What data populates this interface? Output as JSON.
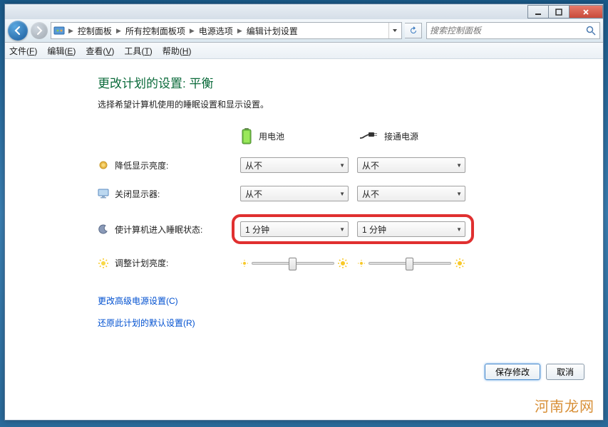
{
  "breadcrumb": {
    "items": [
      "控制面板",
      "所有控制面板项",
      "电源选项",
      "编辑计划设置"
    ]
  },
  "search": {
    "placeholder": "搜索控制面板"
  },
  "menubar": {
    "file": "文件",
    "file_u": "F",
    "edit": "编辑",
    "edit_u": "E",
    "view": "查看",
    "view_u": "V",
    "tools": "工具",
    "tools_u": "T",
    "help": "帮助",
    "help_u": "H"
  },
  "page": {
    "title": "更改计划的设置: 平衡",
    "subtitle": "选择希望计算机使用的睡眠设置和显示设置。"
  },
  "columns": {
    "battery": "用电池",
    "plugged": "接通电源"
  },
  "rows": {
    "dim": {
      "label": "降低显示亮度:"
    },
    "display": {
      "label": "关闭显示器:"
    },
    "sleep": {
      "label": "使计算机进入睡眠状态:"
    },
    "brightness": {
      "label": "调整计划亮度:"
    }
  },
  "values": {
    "dim_battery": "从不",
    "dim_plugged": "从不",
    "display_battery": "从不",
    "display_plugged": "从不",
    "sleep_battery": "1 分钟",
    "sleep_plugged": "1 分钟",
    "brightness_battery_pct": 45,
    "brightness_plugged_pct": 45
  },
  "links": {
    "advanced": "更改高级电源设置(C)",
    "restore": "还原此计划的默认设置(R)"
  },
  "buttons": {
    "save": "保存修改",
    "cancel": "取消"
  },
  "watermark": "河南龙网"
}
